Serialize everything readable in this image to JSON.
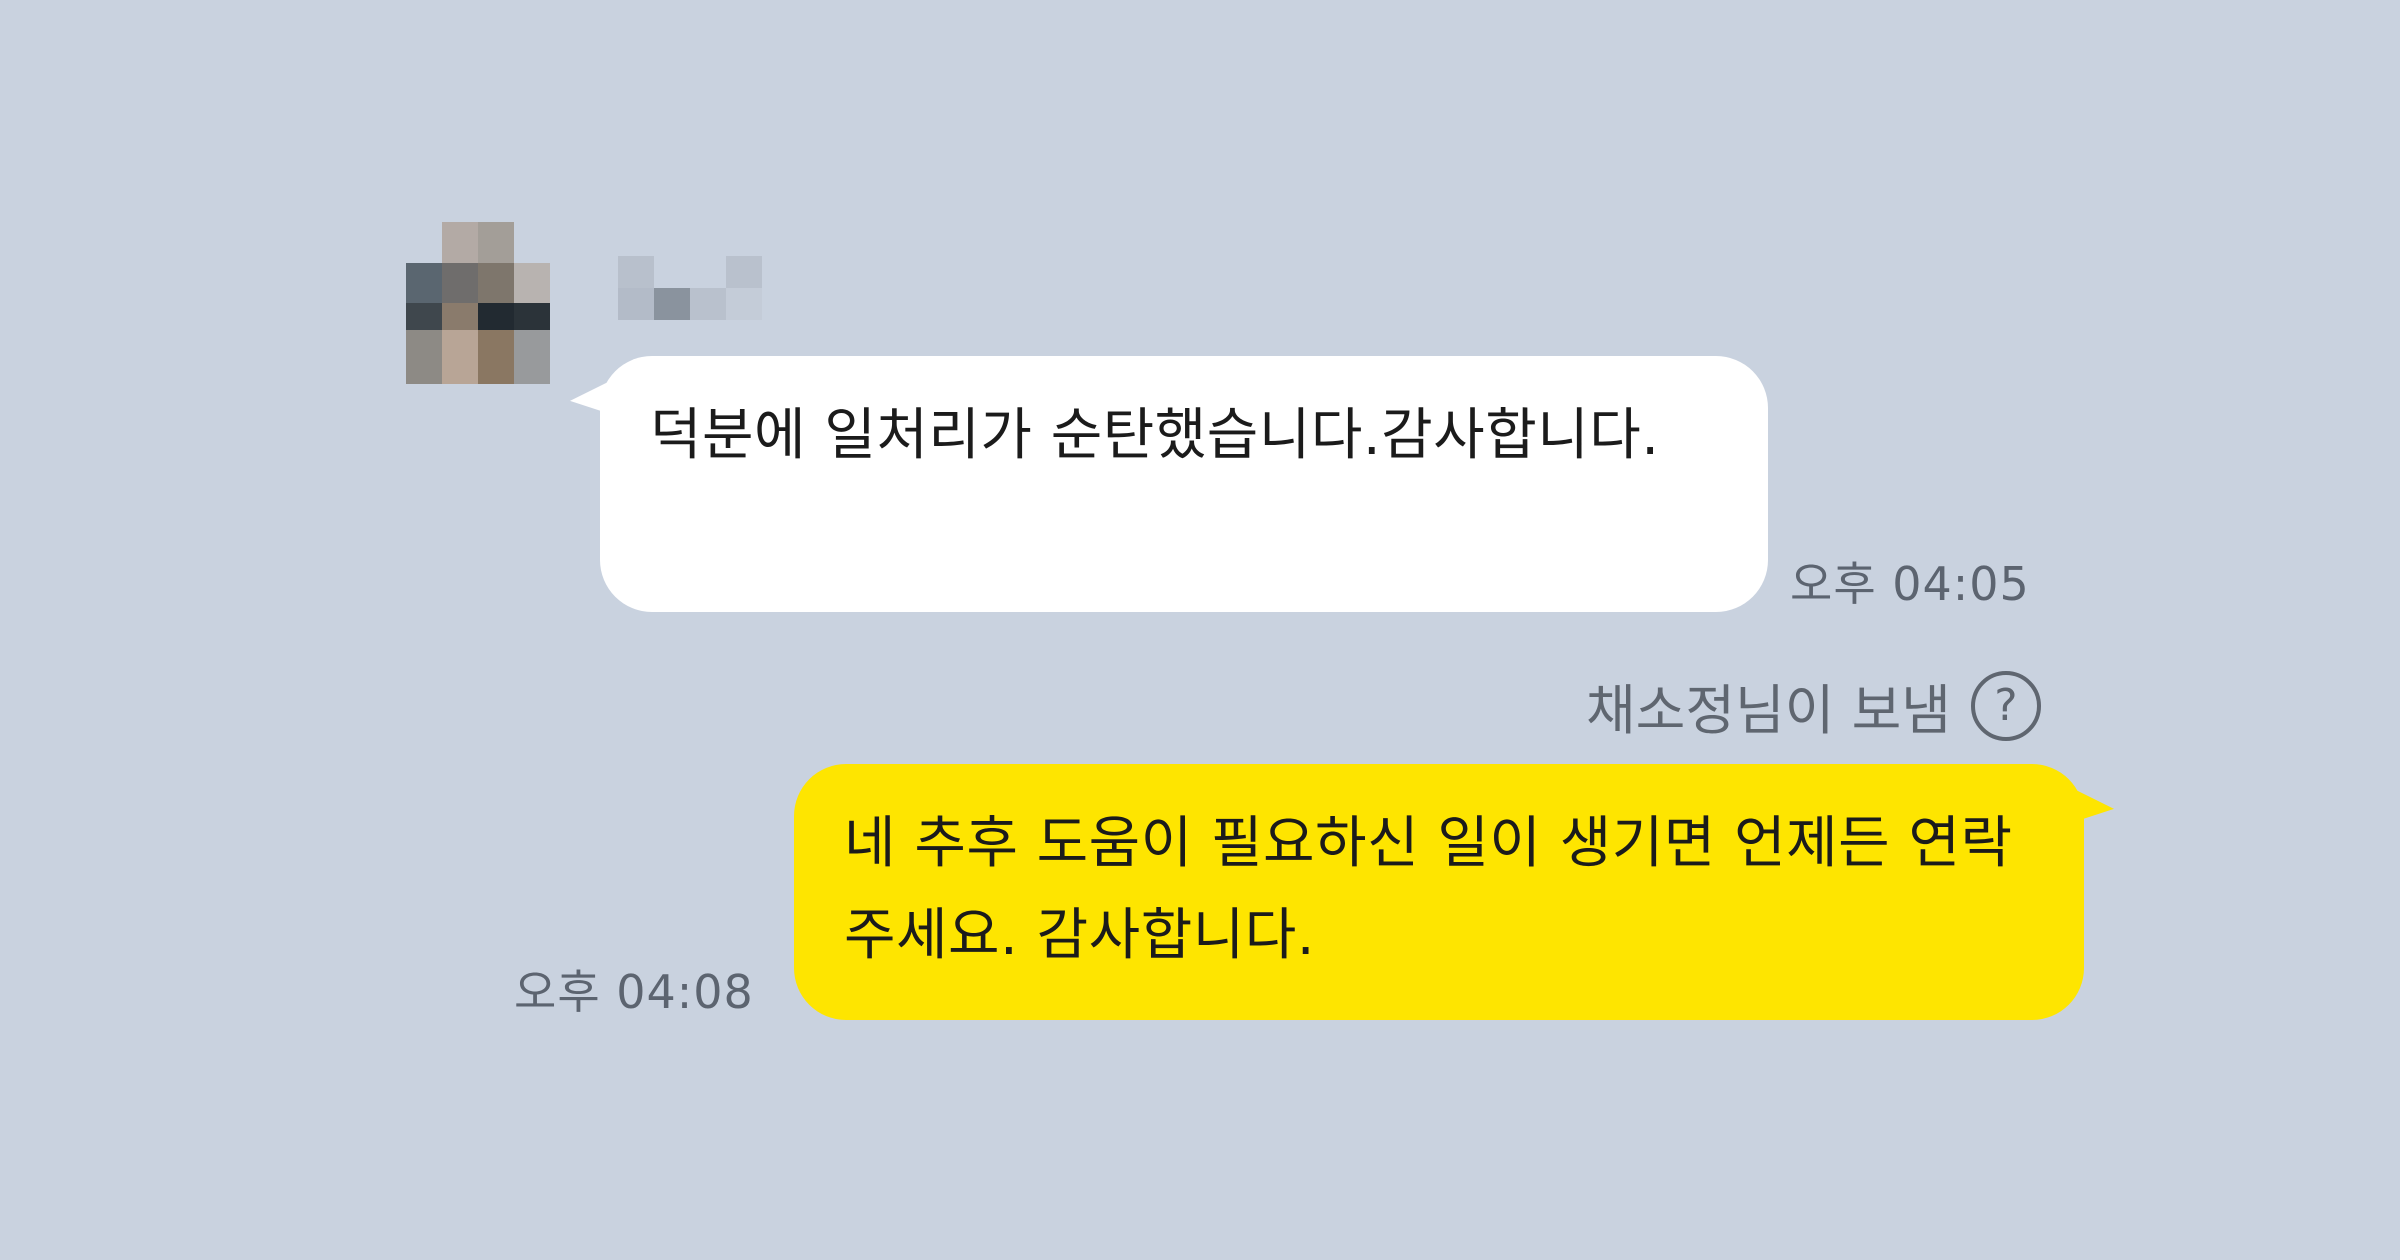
{
  "chat": {
    "incoming": {
      "avatar": "blurred-profile-avatar",
      "message": "덕분에 일처리가 순탄했습니다.감사합니다.",
      "time": "오후 04:05",
      "bubble_color": "#ffffff"
    },
    "sent_by": {
      "label": "채소정님이 보냄",
      "help_icon": "?"
    },
    "outgoing": {
      "message": "네 추후 도움이 필요하신 일이 생기면 언제든 연락 주세요. 감사합니다.",
      "time": "오후 04:08",
      "bubble_color": "#fee500"
    },
    "background_color": "#c9d2df"
  }
}
